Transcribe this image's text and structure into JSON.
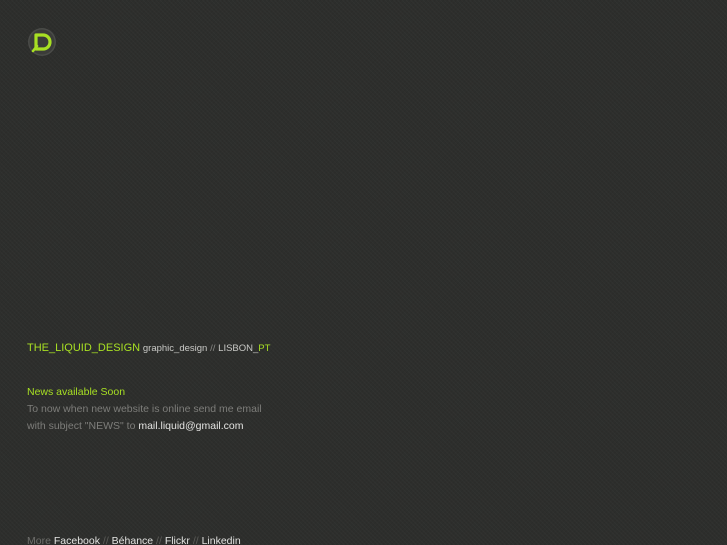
{
  "logo": {
    "icon": "liquid-design-logo-icon",
    "accent": "#a8e023"
  },
  "brand": {
    "name": "THE_LIQUID_DESIGN",
    "category": "graphic_design",
    "separator": "//",
    "location_prefix": "LISBON_",
    "location_suffix": "PT"
  },
  "news": {
    "title": "News available Soon",
    "line1": "To now when new website is online send me email",
    "line2_prefix": "with subject \"NEWS\" to",
    "email": "mail.liquid@gmail.com"
  },
  "footer": {
    "more_label": "More",
    "links": [
      "Facebook",
      "Béhance",
      "Flickr",
      "Linkedin"
    ],
    "separator": "//"
  },
  "colors": {
    "background": "#2d2e2c",
    "accent": "#a8e023",
    "muted_text": "#8a8a87",
    "link_text": "#e4e4e2"
  }
}
